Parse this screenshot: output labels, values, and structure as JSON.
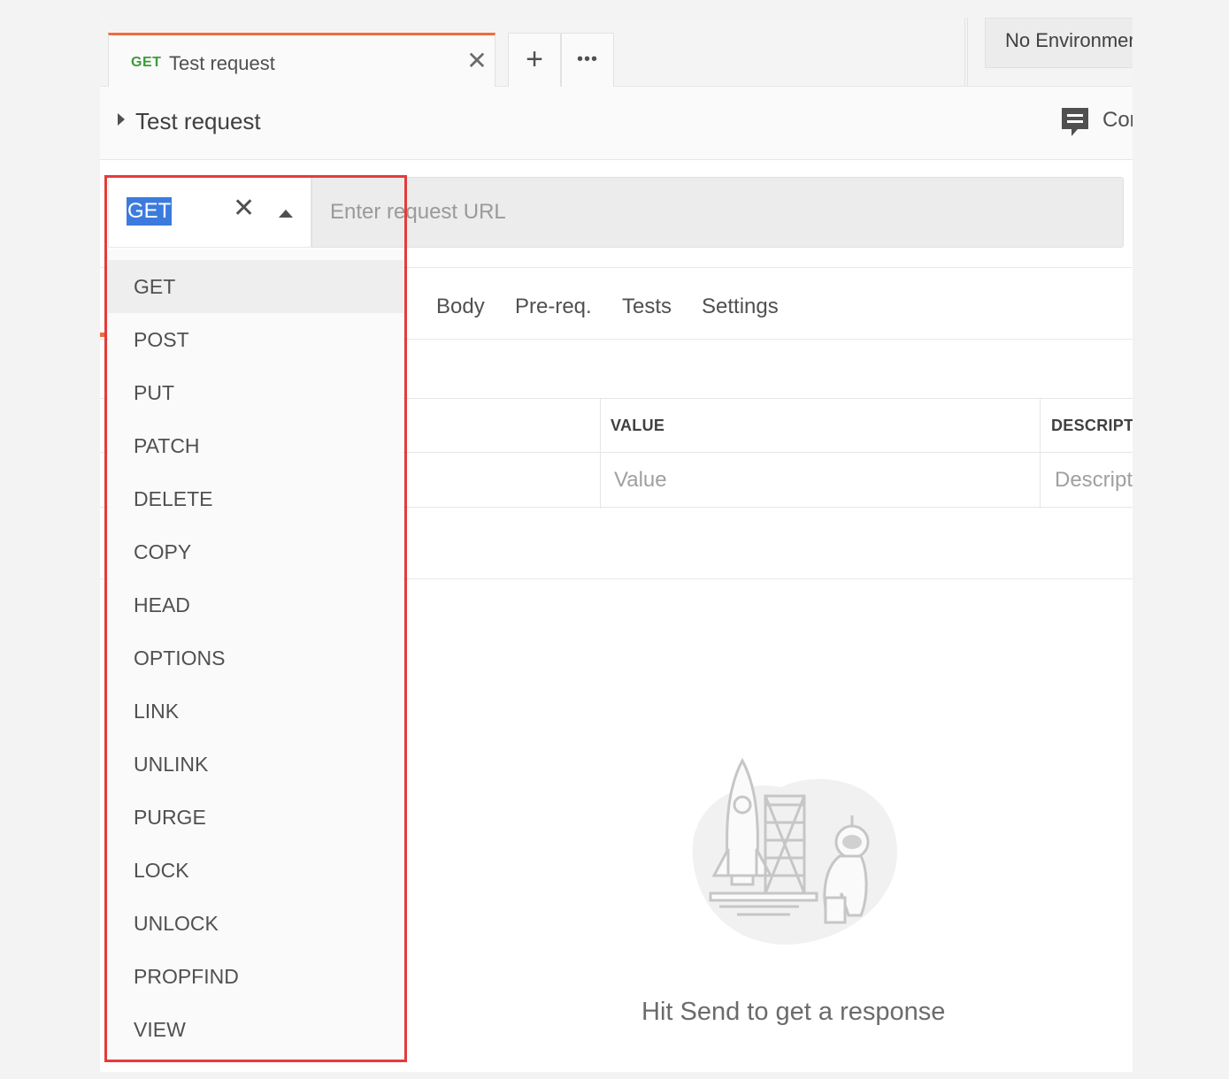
{
  "tab": {
    "method": "GET",
    "name": "Test request",
    "close_glyph": "✕",
    "add_glyph": "+",
    "more_glyph": "•••"
  },
  "environment": {
    "selected": "No Environment"
  },
  "request": {
    "title": "Test request",
    "comments_label": "Comments",
    "method_value": "GET",
    "clear_glyph": "✕",
    "url_placeholder": "Enter request URL"
  },
  "subtabs": [
    "Body",
    "Pre-req.",
    "Tests",
    "Settings"
  ],
  "params_table": {
    "columns": [
      "VALUE",
      "DESCRIPTION"
    ],
    "placeholders": [
      "Value",
      "Description"
    ]
  },
  "response": {
    "empty_message": "Hit Send to get a response"
  },
  "method_dropdown": {
    "active": "GET",
    "options": [
      "GET",
      "POST",
      "PUT",
      "PATCH",
      "DELETE",
      "COPY",
      "HEAD",
      "OPTIONS",
      "LINK",
      "UNLINK",
      "PURGE",
      "LOCK",
      "UNLOCK",
      "PROPFIND",
      "VIEW"
    ]
  },
  "colors": {
    "accent_orange": "#f26b3a",
    "get_green": "#3c9b3c",
    "highlight_red": "#e53b3b",
    "selection_blue": "#3b7bde"
  }
}
